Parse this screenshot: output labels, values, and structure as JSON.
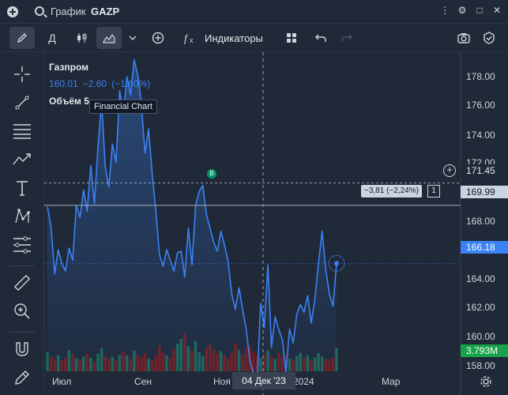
{
  "titlebar": {
    "title": "График",
    "symbol": "GAZP"
  },
  "toolbar": {
    "interval": "Д",
    "indicators": "Индикаторы"
  },
  "legend": {
    "name": "Газпром",
    "price": "160.01",
    "change": "−2.60",
    "change_pct": "(−1.60%)",
    "volume": "Объём 5",
    "tooltip": "Financial Chart"
  },
  "price_axis": {
    "labels": [
      "178.00",
      "176.00",
      "174.00",
      "172.00",
      "170.00",
      "168.00",
      "164.00",
      "162.00",
      "160.00",
      "158.00"
    ],
    "tag_high": "171.45",
    "tag_crosshair": "169.99",
    "tag_last": "166.18",
    "tag_volume": "3.793M"
  },
  "crosshair": {
    "delta": "−3,81 (−2,24%)",
    "count": "1",
    "date": "04 Дек '23"
  },
  "time_axis": {
    "labels": [
      "Июл",
      "Сен",
      "Ноя",
      "2024",
      "Мар"
    ]
  },
  "marker_label": "B",
  "colors": {
    "line": "#3b82f6",
    "volume_up": "#1f6f5c",
    "volume_down": "#7f1d1d",
    "tag_last": "#3b82f6",
    "tag_volume": "#16a34a"
  },
  "chart_data": {
    "type": "line",
    "y_range": [
      157.6,
      180
    ],
    "values": [
      169.9,
      168.6,
      165.5,
      167.1,
      166.2,
      165.7,
      167.2,
      166.4,
      170.0,
      169.2,
      171.0,
      169.6,
      172.6,
      170.1,
      173.8,
      176.8,
      172.5,
      171.2,
      174.0,
      172.8,
      177.5,
      176.0,
      178.4,
      177.2,
      179.5,
      178.5,
      176.6,
      173.4,
      175.0,
      172.0,
      169.6,
      166.8,
      166.0,
      167.1,
      166.4,
      165.7,
      166.9,
      167.0,
      165.3,
      168.5,
      166.1,
      170.0,
      170.9,
      171.3,
      169.4,
      168.5,
      167.6,
      167.0,
      168.3,
      167.4,
      166.3,
      164.2,
      163.2,
      164.6,
      163.2,
      161.9,
      159.9,
      159.0,
      158.5,
      163.6,
      162.0,
      166.1,
      160.7,
      162.7,
      161.9,
      161.2,
      159.1,
      161.9,
      161.0,
      162.9,
      163.5,
      163.0,
      164.1,
      162.3,
      163.9,
      166.2,
      168.3,
      165.8,
      164.2,
      163.4,
      166.2
    ],
    "volume": [
      3.1,
      2.4,
      2.0,
      2.6,
      1.8,
      2.2,
      3.5,
      2.8,
      2.1,
      1.9,
      2.4,
      3.0,
      2.2,
      1.6,
      2.9,
      3.8,
      2.5,
      2.0,
      2.4,
      1.9,
      2.7,
      3.2,
      2.6,
      2.1,
      3.4,
      2.8,
      2.3,
      3.0,
      2.1,
      1.8,
      2.6,
      4.2,
      3.1,
      2.6,
      2.2,
      3.7,
      4.5,
      5.3,
      6.2,
      4.1,
      3.4,
      5.0,
      3.1,
      2.5,
      3.8,
      4.4,
      3.6,
      2.9,
      3.3,
      2.7,
      2.1,
      3.0,
      4.6,
      3.5,
      2.8,
      3.9,
      4.3,
      3.2,
      2.6,
      2.2,
      2.8,
      3.4,
      2.5,
      2.0,
      3.1,
      2.4,
      2.7,
      2.1,
      1.9,
      2.5,
      3.0,
      2.2,
      2.6,
      1.8,
      2.3,
      3.0,
      2.4,
      2.0,
      1.7,
      2.2,
      3.79
    ]
  }
}
